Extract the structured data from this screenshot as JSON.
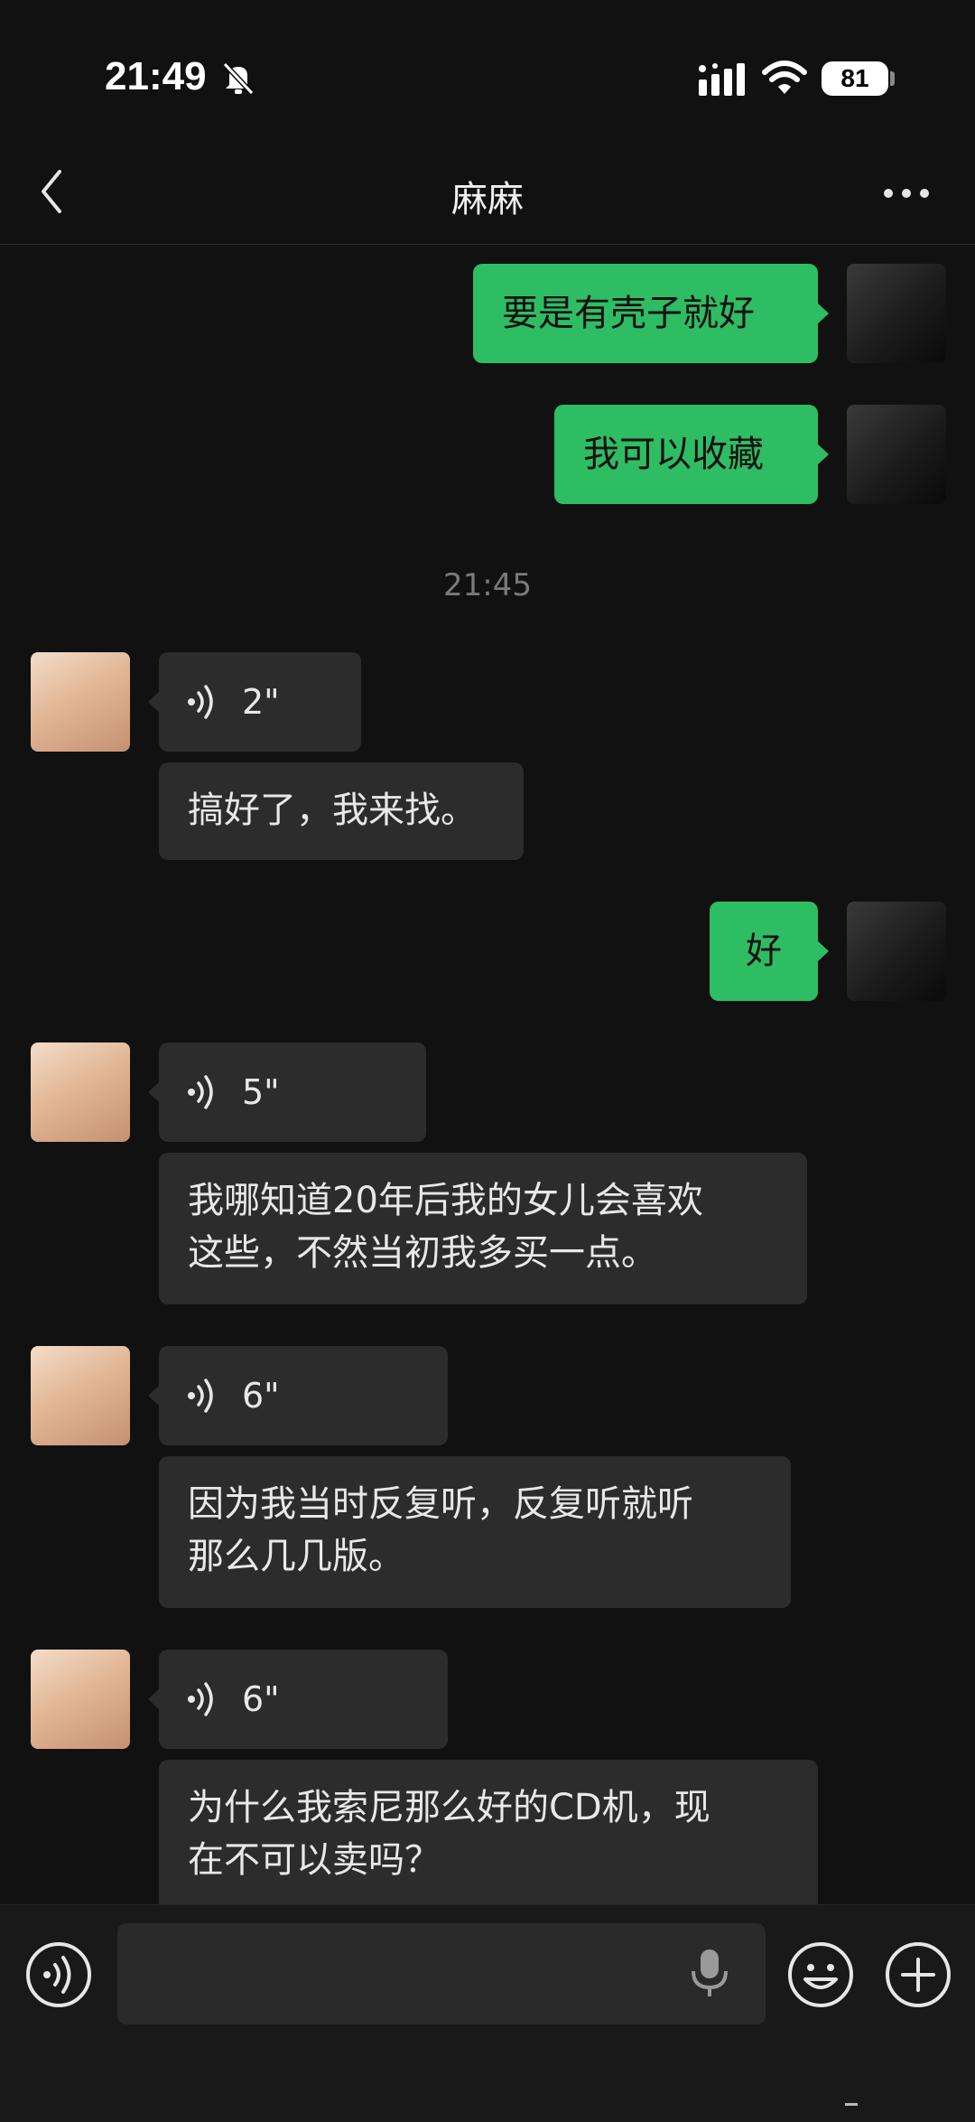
{
  "status_bar": {
    "time": "21:49",
    "battery": "81"
  },
  "header": {
    "title": "麻麻"
  },
  "messages": {
    "m1": "要是有壳子就好",
    "m2": "我可以收藏",
    "ts1": "21:45",
    "v1": "2\"",
    "m3": "搞好了，我来找。",
    "m4": "好",
    "v2": "5\"",
    "m5_line1": "我哪知道20年后我的女儿会喜欢",
    "m5_line2": "这些，不然当初我多买一点。",
    "v3": "6\"",
    "m6_line1": "因为我当时反复听，反复听就听",
    "m6_line2": "那么几几版。",
    "v4": "6\"",
    "m7_line1": "为什么我索尼那么好的CD机，现",
    "m7_line2": "在不可以卖吗？"
  },
  "colors": {
    "outgoing": "#2ebd63",
    "incoming": "#2c2c2c",
    "background": "#111111"
  },
  "icons": [
    "bell-muted-icon",
    "signal-icon",
    "wifi-icon",
    "back-icon",
    "more-icon",
    "voice-wave-icon",
    "voice-toggle-icon",
    "microphone-icon",
    "emoji-icon",
    "plus-icon"
  ]
}
